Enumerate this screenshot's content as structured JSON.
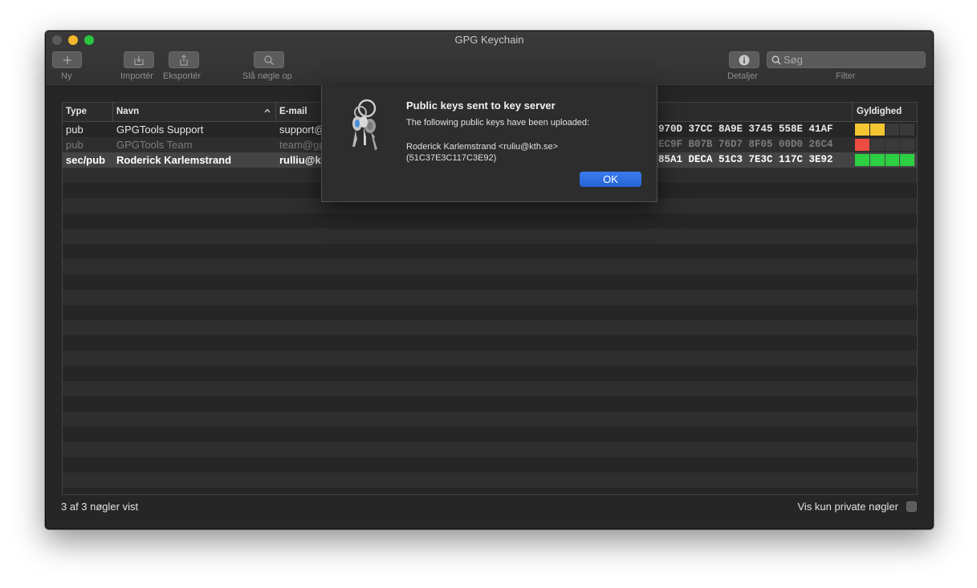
{
  "window": {
    "title": "GPG Keychain"
  },
  "toolbar": {
    "new_label": "Ny",
    "import_label": "Importér",
    "export_label": "Eksportér",
    "lookup_label": "Slå nøgle op",
    "details_label": "Detaljer",
    "filter_label": "Filter",
    "search_placeholder": "Søg"
  },
  "table": {
    "columns": {
      "type": "Type",
      "name": "Navn",
      "email": "E-mail",
      "validity": "Gyldighed"
    },
    "rows": [
      {
        "type": "pub",
        "name": "GPGTools Support",
        "email": "support@",
        "fingerprint": "970D  37CC 8A9E 3745 558E 41AF",
        "validity_level": 2,
        "validity_color": "#f2c531"
      },
      {
        "type": "pub",
        "name": "GPGTools Team",
        "email": "team@gp",
        "fingerprint": "EC9F  B07B 76D7 8F05 00D0 26C4",
        "validity_level": 1,
        "validity_color": "#ee4b42"
      },
      {
        "type": "sec/pub",
        "name": "Roderick Karlemstrand",
        "email": "rulliu@kt",
        "fingerprint": "85A1  DECA 51C3 7E3C 117C 3E92",
        "validity_level": 4,
        "validity_color": "#2ecf43"
      }
    ]
  },
  "status": {
    "count_text": "3 af 3 nøgler vist",
    "private_only_label": "Vis kun private nøgler"
  },
  "dialog": {
    "title": "Public keys sent to key server",
    "message": "The following public keys have been uploaded:",
    "detail": "Roderick Karlemstrand <ruliu@kth.se>\n(51C37E3C117C3E92)",
    "ok_label": "OK",
    "icon": "keychain-keys-icon"
  }
}
